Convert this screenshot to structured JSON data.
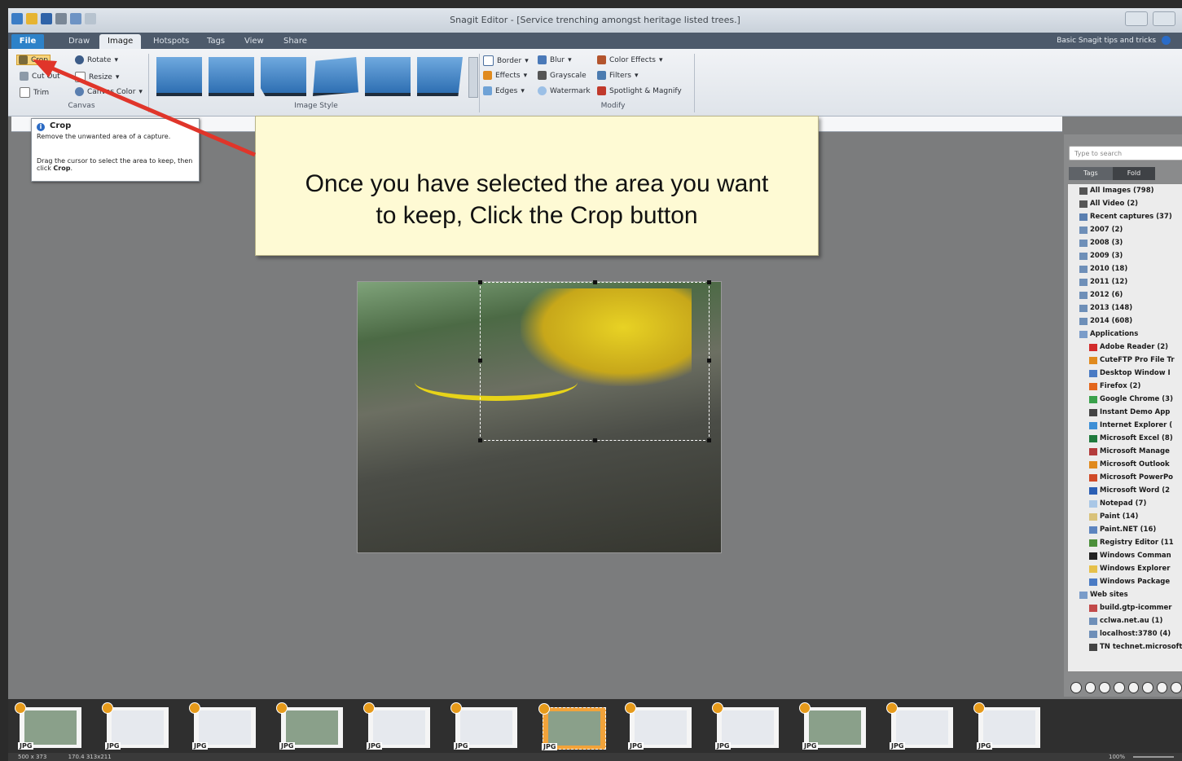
{
  "window": {
    "title": "Snagit Editor - [Service trenching amongst heritage listed trees.]",
    "controls": [
      "minimize",
      "restore",
      "close"
    ]
  },
  "tabs": [
    {
      "label": "File",
      "state": "file"
    },
    {
      "label": "Draw",
      "state": "normal"
    },
    {
      "label": "Image",
      "state": "active"
    },
    {
      "label": "Hotspots",
      "state": "normal"
    },
    {
      "label": "Tags",
      "state": "normal"
    },
    {
      "label": "View",
      "state": "normal"
    },
    {
      "label": "Share",
      "state": "normal"
    }
  ],
  "help_link": "Basic Snagit tips and tricks",
  "ribbon": {
    "canvas": {
      "label": "Canvas",
      "crop": "Crop",
      "rotate": "Rotate",
      "cut_out": "Cut Out",
      "resize": "Resize",
      "trim": "Trim",
      "canvas_color": "Canvas Color"
    },
    "image_style": {
      "label": "Image Style"
    },
    "modify": {
      "label": "Modify",
      "border": "Border",
      "effects": "Effects",
      "edges": "Edges",
      "blur": "Blur",
      "grayscale": "Grayscale",
      "watermark": "Watermark",
      "color_effects": "Color Effects",
      "filters": "Filters",
      "spotlight": "Spotlight & Magnify"
    }
  },
  "tooltip": {
    "title": "Crop",
    "line1": "Remove the unwanted area of a capture.",
    "line2_a": "Drag the cursor to select the area to keep, then click ",
    "line2_b": "Crop",
    "line2_c": "."
  },
  "callout": {
    "line1": "Once you have selected the area you want",
    "line2": "to keep, Click the Crop button"
  },
  "library": {
    "search_placeholder": "Type to search",
    "tab_tags": "Tags",
    "tab_folders": "Fold",
    "items": [
      {
        "label": "All Images (798)",
        "indent": 0,
        "color": "#555555"
      },
      {
        "label": "All Video (2)",
        "indent": 0,
        "color": "#555555"
      },
      {
        "label": "Recent captures (37)",
        "indent": 0,
        "color": "#5a7fb0"
      },
      {
        "label": "2007 (2)",
        "indent": 0,
        "color": "#6e8fb8"
      },
      {
        "label": "2008 (3)",
        "indent": 0,
        "color": "#6e8fb8"
      },
      {
        "label": "2009 (3)",
        "indent": 0,
        "color": "#6e8fb8"
      },
      {
        "label": "2010 (18)",
        "indent": 0,
        "color": "#6e8fb8"
      },
      {
        "label": "2011 (12)",
        "indent": 0,
        "color": "#6e8fb8"
      },
      {
        "label": "2012 (6)",
        "indent": 0,
        "color": "#6e8fb8"
      },
      {
        "label": "2013 (148)",
        "indent": 0,
        "color": "#6e8fb8"
      },
      {
        "label": "2014 (608)",
        "indent": 0,
        "color": "#6e8fb8"
      },
      {
        "label": "Applications",
        "indent": 0,
        "color": "#7a9cc9"
      },
      {
        "label": "Adobe Reader (2)",
        "indent": 1,
        "color": "#d22b2b"
      },
      {
        "label": "CuteFTP Pro File Tr",
        "indent": 1,
        "color": "#e08a1e"
      },
      {
        "label": "Desktop Window I",
        "indent": 1,
        "color": "#4a7bc4"
      },
      {
        "label": "Firefox (2)",
        "indent": 1,
        "color": "#e3661c"
      },
      {
        "label": "Google Chrome (3)",
        "indent": 1,
        "color": "#3aa14b"
      },
      {
        "label": "Instant Demo App",
        "indent": 1,
        "color": "#444444"
      },
      {
        "label": "Internet Explorer (",
        "indent": 1,
        "color": "#3d8fd6"
      },
      {
        "label": "Microsoft Excel (8)",
        "indent": 1,
        "color": "#1f7a3d"
      },
      {
        "label": "Microsoft Manage",
        "indent": 1,
        "color": "#b33b3b"
      },
      {
        "label": "Microsoft Outlook",
        "indent": 1,
        "color": "#e08a1e"
      },
      {
        "label": "Microsoft PowerPo",
        "indent": 1,
        "color": "#d04a27"
      },
      {
        "label": "Microsoft Word (2",
        "indent": 1,
        "color": "#2b5fb4"
      },
      {
        "label": "Notepad (7)",
        "indent": 1,
        "color": "#a9c7e6"
      },
      {
        "label": "Paint (14)",
        "indent": 1,
        "color": "#d9c27a"
      },
      {
        "label": "Paint.NET (16)",
        "indent": 1,
        "color": "#5c84bf"
      },
      {
        "label": "Registry Editor (11",
        "indent": 1,
        "color": "#4b8f3a"
      },
      {
        "label": "Windows Comman",
        "indent": 1,
        "color": "#222222"
      },
      {
        "label": "Windows Explorer",
        "indent": 1,
        "color": "#e6c04a"
      },
      {
        "label": "Windows Package",
        "indent": 1,
        "color": "#4a7bc4"
      },
      {
        "label": "Web sites",
        "indent": 0,
        "color": "#7a9cc9"
      },
      {
        "label": "build.gtp-icommer",
        "indent": 1,
        "color": "#c24a4a"
      },
      {
        "label": "cclwa.net.au (1)",
        "indent": 1,
        "color": "#6e8fb8"
      },
      {
        "label": "localhost:3780 (4)",
        "indent": 1,
        "color": "#6e8fb8"
      },
      {
        "label": "TN technet.microsoft",
        "indent": 1,
        "color": "#444444"
      }
    ]
  },
  "filmstrip": {
    "thumbs": [
      {
        "tag": "JPG",
        "selected": false
      },
      {
        "tag": "JPG",
        "selected": false
      },
      {
        "tag": "JPG",
        "selected": false
      },
      {
        "tag": "JPG",
        "selected": false
      },
      {
        "tag": "JPG",
        "selected": false
      },
      {
        "tag": "JPG",
        "selected": false
      },
      {
        "tag": "JPG",
        "selected": true
      },
      {
        "tag": "JPG",
        "selected": false
      },
      {
        "tag": "JPG",
        "selected": false
      },
      {
        "tag": "JPG",
        "selected": false
      },
      {
        "tag": "JPG",
        "selected": false
      },
      {
        "tag": "JPG",
        "selected": false
      }
    ]
  },
  "status": {
    "dimensions": "500 x 373",
    "position": "170.4  313x211",
    "zoom": "100%"
  }
}
